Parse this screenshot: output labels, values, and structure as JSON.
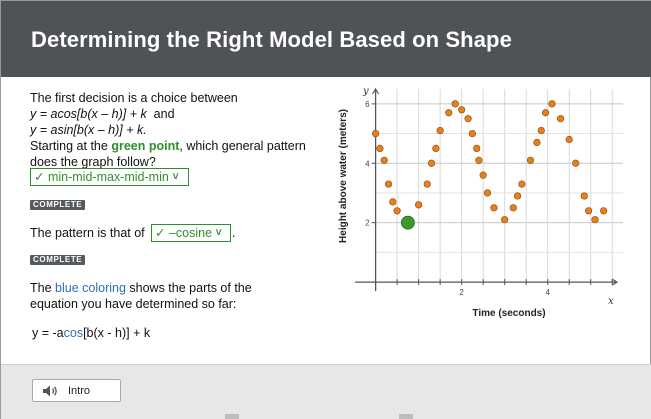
{
  "header": {
    "title": "Determining the Right Model Based on Shape"
  },
  "content": {
    "para1": {
      "line1": "The first decision is a choice between",
      "eq1": "y = acos[b(x – h)] + k",
      "and": "and",
      "eq2": "y = asin[b(x – h)] + k.",
      "starting": "Starting at the",
      "green_point": "green point",
      "question_rest": ", which general pattern",
      "question_line2": "does the graph follow?"
    },
    "dropdown1": {
      "check": "✓",
      "value": "min-mid-max-mid-min"
    },
    "badge1": "COMPLETE",
    "para2": {
      "prefix": "The pattern is that of",
      "suffix": "."
    },
    "dropdown2": {
      "check": "✓",
      "value": "–cosine"
    },
    "badge2": "COMPLETE",
    "para3": {
      "prefix": "The",
      "blue_coloring": "blue coloring",
      "rest": "shows the parts of the",
      "line2": "equation you have determined so far:"
    },
    "equation": {
      "pre": "y = ",
      "neg": "-a",
      "cos": "cos",
      "post": "[b(x - h)] + k"
    }
  },
  "chart_data": {
    "type": "scatter",
    "title": "",
    "xlabel": "Time (seconds)",
    "ylabel": "Height above water (meters)",
    "x_axis_letter": "x",
    "y_axis_letter": "y",
    "xlim": [
      -0.2,
      5.75
    ],
    "ylim": [
      -0.3,
      6.5
    ],
    "x_ticks": [
      2,
      4
    ],
    "y_ticks": [
      2,
      4,
      6
    ],
    "grid": true,
    "series": [
      {
        "color": "#e8801a",
        "points": [
          [
            0,
            5
          ],
          [
            0.1,
            4.5
          ],
          [
            0.2,
            4.1
          ],
          [
            0.3,
            3.3
          ],
          [
            0.4,
            2.7
          ],
          [
            0.5,
            2.4
          ],
          [
            1.0,
            2.6
          ],
          [
            1.2,
            3.3
          ],
          [
            1.3,
            4.0
          ],
          [
            1.4,
            4.5
          ],
          [
            1.5,
            5.1
          ],
          [
            1.7,
            5.7
          ],
          [
            1.85,
            6.0
          ],
          [
            2.0,
            5.8
          ],
          [
            2.15,
            5.5
          ],
          [
            2.25,
            5.0
          ],
          [
            2.35,
            4.5
          ],
          [
            2.4,
            4.1
          ],
          [
            2.5,
            3.6
          ],
          [
            2.6,
            3.0
          ],
          [
            2.75,
            2.5
          ],
          [
            3.0,
            2.1
          ],
          [
            3.2,
            2.5
          ],
          [
            3.3,
            2.9
          ],
          [
            3.4,
            3.3
          ],
          [
            3.6,
            4.1
          ],
          [
            3.75,
            4.7
          ],
          [
            3.85,
            5.1
          ],
          [
            3.95,
            5.7
          ],
          [
            4.1,
            6.0
          ],
          [
            4.3,
            5.5
          ],
          [
            4.5,
            4.8
          ],
          [
            4.65,
            4.0
          ],
          [
            4.85,
            2.9
          ],
          [
            4.95,
            2.4
          ],
          [
            5.1,
            2.1
          ],
          [
            5.3,
            2.4
          ]
        ]
      }
    ],
    "highlight_point": {
      "x": 0.75,
      "y": 2.0,
      "color": "#3c9a2c"
    }
  },
  "footer": {
    "intro_label": "Intro"
  }
}
